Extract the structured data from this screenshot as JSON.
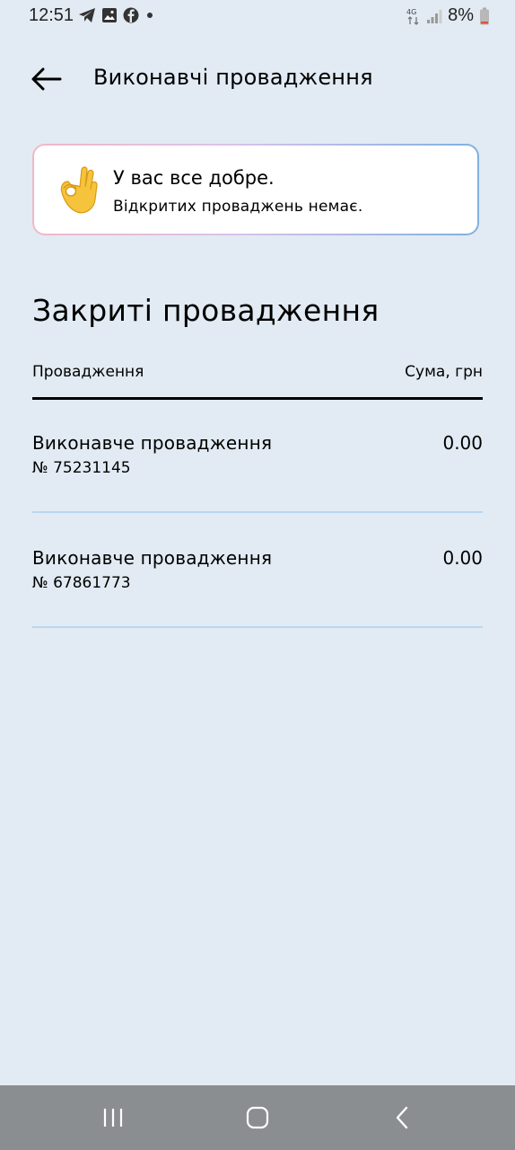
{
  "status_bar": {
    "time": "12:51",
    "battery_percent": "8%",
    "network_type": "4G",
    "left_icons": [
      "telegram-icon",
      "gallery-icon",
      "facebook-icon",
      "dot-icon"
    ],
    "right_icons": [
      "network-4g-icon",
      "signal-icon",
      "battery-icon"
    ]
  },
  "header": {
    "title": "Виконавчі провадження",
    "back_icon": "arrow-left-icon"
  },
  "alert": {
    "emoji_icon": "ok-hand-icon",
    "title": "У вас все добре.",
    "subtitle": "Відкритих проваджень немає."
  },
  "closed_section": {
    "title": "Закриті провадження",
    "columns": {
      "left": "Провадження",
      "right": "Сума, грн"
    },
    "rows": [
      {
        "title": "Виконавче провадження",
        "number": "№ 75231145",
        "amount": "0.00"
      },
      {
        "title": "Виконавче провадження",
        "number": "№ 67861773",
        "amount": "0.00"
      }
    ]
  },
  "nav_bar": {
    "recent_icon": "recent-apps-icon",
    "home_icon": "home-icon",
    "back_icon": "back-icon"
  },
  "colors": {
    "background": "#e2ebf3",
    "row_divider": "#b9d6ee",
    "nav_bar": "#8b8e91"
  }
}
